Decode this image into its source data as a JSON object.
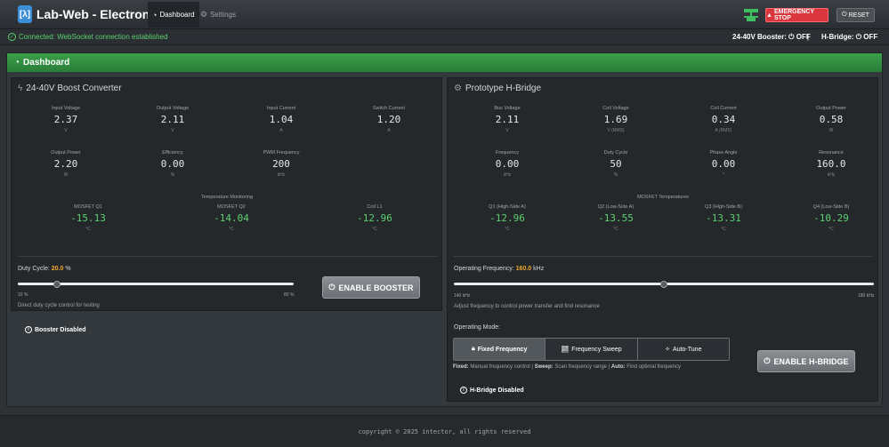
{
  "app": {
    "title": "Lab-Web - Electronics Lab",
    "logo": "[λ]",
    "tabs": [
      {
        "label": "Dashboard",
        "icon": "gauge-icon"
      },
      {
        "label": "Settings",
        "icon": "gear-icon"
      }
    ],
    "emergency_stop": "EMERGENCY STOP",
    "reset": "RESET"
  },
  "status": {
    "connection": "Connected: WebSocket connection established",
    "booster_label": "24-40V Booster:",
    "booster_state": "OFF",
    "hbridge_label": "H-Bridge:",
    "hbridge_state": "OFF",
    "separator": "|"
  },
  "dashboard": {
    "title": "Dashboard",
    "booster": {
      "title": "24-40V Boost Converter",
      "metrics": [
        {
          "label": "Input Voltage",
          "value": "2.37",
          "unit": "V"
        },
        {
          "label": "Output Voltage",
          "value": "2.11",
          "unit": "V"
        },
        {
          "label": "Input Current",
          "value": "1.04",
          "unit": "A"
        },
        {
          "label": "Switch Current",
          "value": "1.20",
          "unit": "A"
        },
        {
          "label": "Output Power",
          "value": "2.20",
          "unit": "W"
        },
        {
          "label": "Efficiency",
          "value": "0.00",
          "unit": "%"
        },
        {
          "label": "PWM Frequency",
          "value": "200",
          "unit": "kHz"
        }
      ],
      "temp_title": "Temperature Monitoring",
      "temps": [
        {
          "label": "MOSFET Q1",
          "value": "-15.13",
          "unit": "°C"
        },
        {
          "label": "MOSFET Q2",
          "value": "-14.04",
          "unit": "°C"
        },
        {
          "label": "Coil L1",
          "value": "-12.96",
          "unit": "°C"
        }
      ],
      "duty_label": "Duty Cycle:",
      "duty_value": "20.0",
      "duty_unit": "%",
      "duty_fraction": 0.143,
      "slider_min": "10 %",
      "slider_max": "80 %",
      "hint": "Direct duty cycle control for testing",
      "enable_button": "ENABLE BOOSTER",
      "status": "Booster Disabled"
    },
    "hbridge": {
      "title": "Prototype H-Bridge",
      "metrics": [
        {
          "label": "Bus Voltage",
          "value": "2.11",
          "unit": "V"
        },
        {
          "label": "Coil Voltage",
          "value": "1.69",
          "unit": "V (RMS)"
        },
        {
          "label": "Coil Current",
          "value": "0.34",
          "unit": "A (RMS)"
        },
        {
          "label": "Output Power",
          "value": "0.58",
          "unit": "W"
        },
        {
          "label": "Frequency",
          "value": "0.00",
          "unit": "kHz"
        },
        {
          "label": "Duty Cycle",
          "value": "50",
          "unit": "%"
        },
        {
          "label": "Phase Angle",
          "value": "0.00",
          "unit": "°"
        },
        {
          "label": "Resonance",
          "value": "160.0",
          "unit": "kHz"
        }
      ],
      "temp_title": "MOSFET Temperatures",
      "temps": [
        {
          "label": "Q1 (High-Side A)",
          "value": "-12.96",
          "unit": "°C"
        },
        {
          "label": "Q2 (Low-Side A)",
          "value": "-13.55",
          "unit": "°C"
        },
        {
          "label": "Q3 (High-Side B)",
          "value": "-13.31",
          "unit": "°C"
        },
        {
          "label": "Q4 (Low-Side B)",
          "value": "-10.29",
          "unit": "°C"
        }
      ],
      "freq_label": "Operating Frequency:",
      "freq_value": "160.0",
      "freq_unit": "kHz",
      "freq_fraction": 0.5,
      "slider_min": "140 kHz",
      "slider_max": "180 kHz",
      "hint": "Adjust frequency to control power transfer and find resonance",
      "mode_label": "Operating Mode:",
      "modes": [
        {
          "label": "Fixed Frequency",
          "icon": "lock-icon"
        },
        {
          "label": "Frequency Sweep",
          "icon": "chart-icon"
        },
        {
          "label": "Auto-Tune",
          "icon": "magic-icon"
        }
      ],
      "mode_hint": {
        "fixed_b": "Fixed:",
        "fixed_t": "Manual frequency control |",
        "sweep_b": "Sweep:",
        "sweep_t": "Scan frequency range |",
        "auto_b": "Auto:",
        "auto_t": "Find optimal frequency"
      },
      "enable_button": "ENABLE H-BRIDGE",
      "status": "H-Bridge Disabled"
    }
  },
  "footer": "copyright © 2025 intector, all rights reserved",
  "colors": {
    "accent_green": "#2a7d38",
    "danger": "#d9363e",
    "temp_green": "#5bd16f",
    "highlight": "#f0a830"
  }
}
